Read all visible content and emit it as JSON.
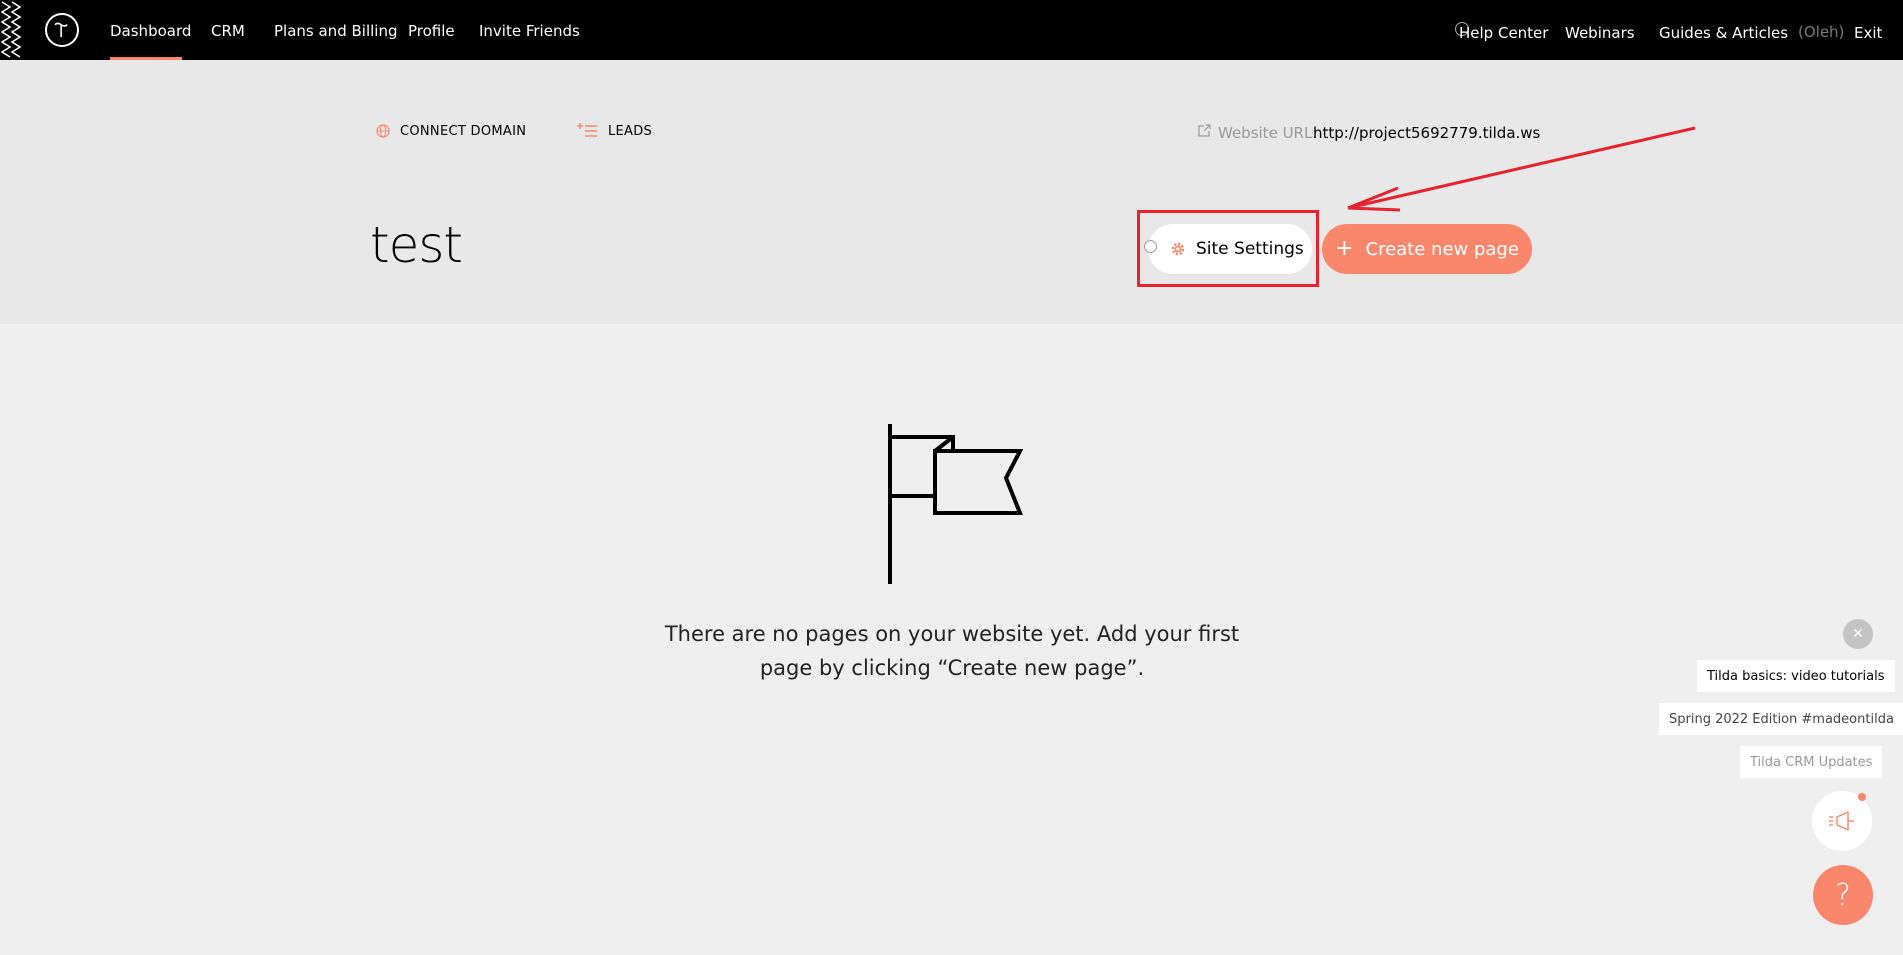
{
  "nav": {
    "items": [
      {
        "label": "Dashboard",
        "active": true
      },
      {
        "label": "CRM"
      },
      {
        "label": "Plans and Billing"
      },
      {
        "label": "Profile"
      },
      {
        "label": "Invite Friends"
      }
    ],
    "right": {
      "help": "Help Center",
      "webinars": "Webinars",
      "guides": "Guides & Articles",
      "user": "(Oleh)",
      "exit": "Exit"
    }
  },
  "project": {
    "connect_domain": "CONNECT DOMAIN",
    "leads": "LEADS",
    "url_label": "Website URL:",
    "url_value": "http://project5692779.tilda.ws",
    "title": "test",
    "settings_label": "Site Settings",
    "create_label": "Create new page",
    "create_icon": "+"
  },
  "empty_state": {
    "message": "There are no pages on your website yet. Add your first page by clicking “Create new page”."
  },
  "widgets": {
    "close_icon": "✕",
    "tutorials": "Tilda basics: video tutorials",
    "edition": "Spring 2022 Edition #madeontilda",
    "crm_updates": "Tilda CRM Updates",
    "help_icon": "?"
  },
  "colors": {
    "accent": "#fa876b",
    "annotation": "#e8222e",
    "topbar": "#000000"
  }
}
